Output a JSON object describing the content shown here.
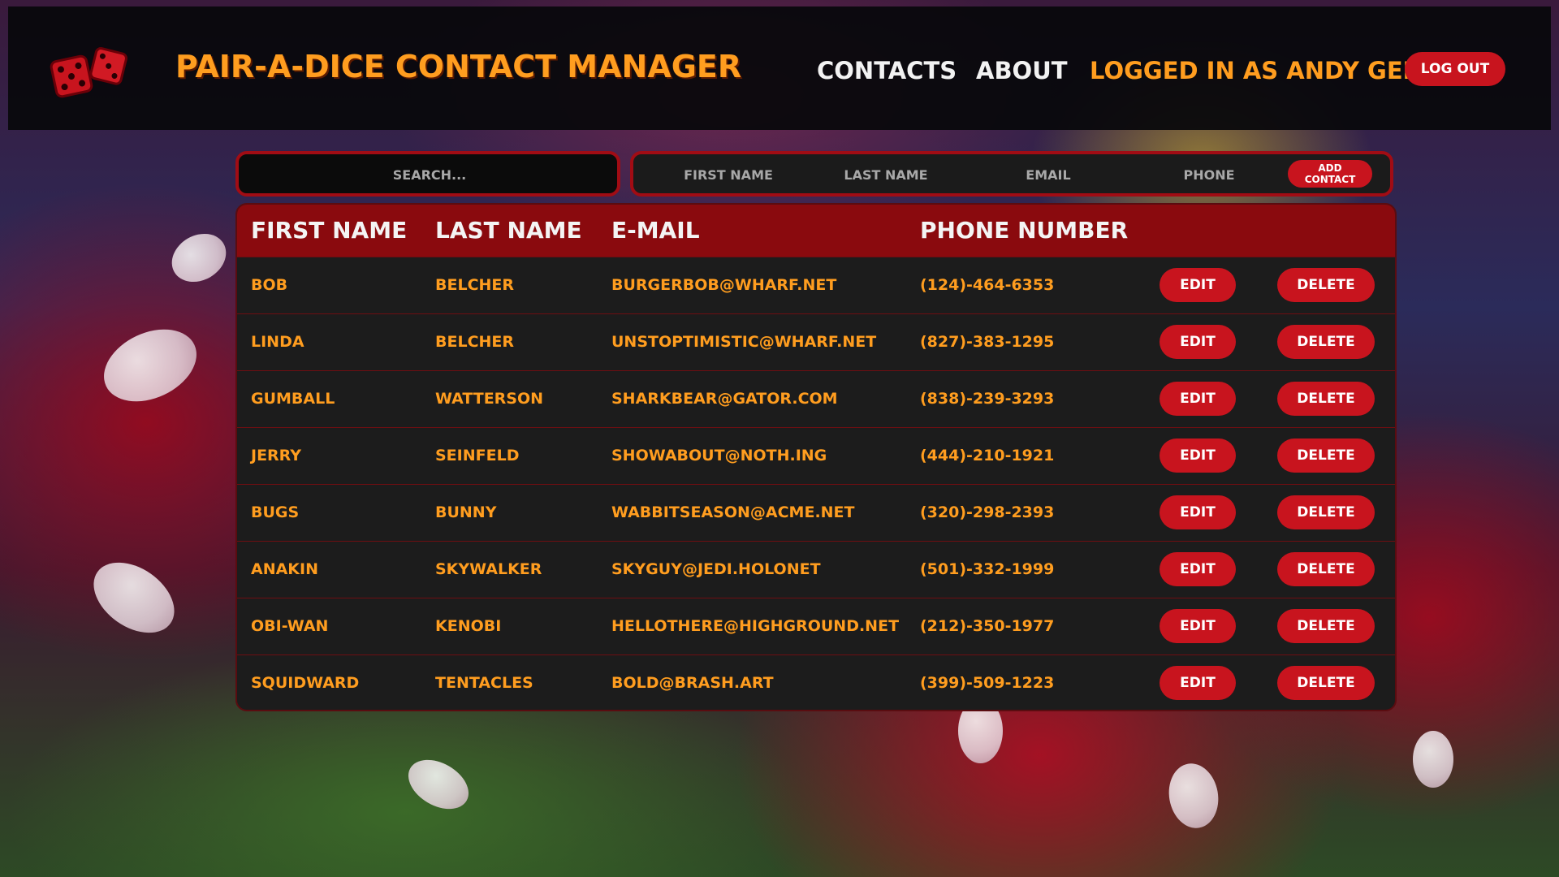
{
  "header": {
    "app_title": "Pair-a-Dice Contact Manager",
    "nav": {
      "contacts_label": "Contacts",
      "about_label": "About"
    },
    "logged_in_text": "Logged in as Andy Gelfo",
    "logout_label": "Log Out"
  },
  "search": {
    "placeholder": "Search...",
    "value": ""
  },
  "add_contact": {
    "first_name_placeholder": "First Name",
    "last_name_placeholder": "Last Name",
    "email_placeholder": "Email",
    "phone_placeholder": "Phone",
    "button_label": "Add Contact"
  },
  "table": {
    "columns": [
      "First Name",
      "Last Name",
      "E-Mail",
      "Phone Number"
    ],
    "edit_label": "Edit",
    "delete_label": "Delete",
    "rows": [
      {
        "first": "Bob",
        "last": "Belcher",
        "email": "burgerbob@wharf.net",
        "phone": "(124)-464-6353"
      },
      {
        "first": "Linda",
        "last": "Belcher",
        "email": "unstoptimistic@wharf.net",
        "phone": "(827)-383-1295"
      },
      {
        "first": "Gumball",
        "last": "Watterson",
        "email": "sharkbear@gator.com",
        "phone": "(838)-239-3293"
      },
      {
        "first": "Jerry",
        "last": "Seinfeld",
        "email": "showabout@noth.ing",
        "phone": "(444)-210-1921"
      },
      {
        "first": "Bugs",
        "last": "Bunny",
        "email": "wabbitseason@acme.net",
        "phone": "(320)-298-2393"
      },
      {
        "first": "Anakin",
        "last": "Skywalker",
        "email": "skyguy@jedi.holonet",
        "phone": "(501)-332-1999"
      },
      {
        "first": "Obi-Wan",
        "last": "Kenobi",
        "email": "hellothere@highground.net",
        "phone": "(212)-350-1977"
      },
      {
        "first": "Squidward",
        "last": "Tentacles",
        "email": "bold@brash.art",
        "phone": "(399)-509-1223"
      }
    ]
  },
  "colors": {
    "accent_orange": "#ff9d1f",
    "button_red": "#c8141e",
    "header_red": "#8a0a0e"
  },
  "icons": {
    "logo": "dice-icon"
  }
}
